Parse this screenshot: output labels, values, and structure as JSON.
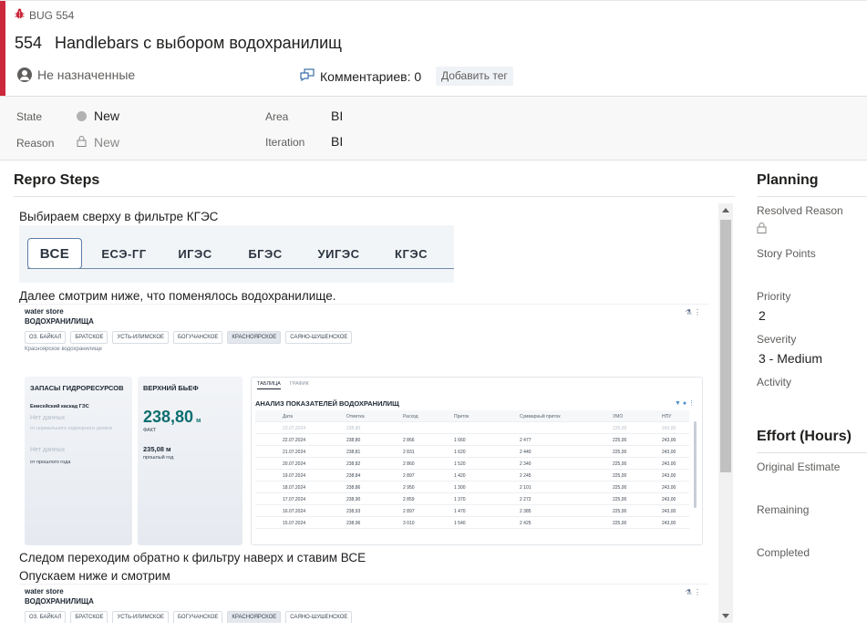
{
  "header": {
    "type_label": "BUG 554",
    "id": "554",
    "title": "Handlebars с выбором водохранилищ",
    "assigned": "Не назначенные",
    "comments": "Комментариев: 0",
    "add_tag": "Добавить тег",
    "accent_color": "#cc293d"
  },
  "fields": {
    "state_label": "State",
    "state_value": "New",
    "reason_label": "Reason",
    "reason_value": "New",
    "area_label": "Area",
    "area_value": "BI",
    "iteration_label": "Iteration",
    "iteration_value": "BI"
  },
  "repro": {
    "title": "Repro Steps",
    "line1": "Выбираем сверху в фильтре КГЭС",
    "tabs": [
      "ВСЕ",
      "ЕСЭ-ГГ",
      "ИГЭС",
      "БГЭС",
      "УИГЭС",
      "КГЭС"
    ],
    "line2": "Далее смотрим ниже, что поменялось водохранилище.",
    "line3": "Следом переходим обратно к фильтру наверх и ставим ВСЕ",
    "line4": "Опускаем ниже и смотрим",
    "dashboard": {
      "app": "water store",
      "section": "ВОДОХРАНИЛИЩА",
      "chips": [
        "ОЗ. БАЙКАЛ",
        "БРАТСКОЕ",
        "УСТЬ-ИЛИМСКОЕ",
        "БОГУЧАНСКОЕ",
        "КРАСНОЯРСКОЕ",
        "САЯНО-ШУШЕНСКОЕ"
      ],
      "selected_note": "Красноярское водохранилище",
      "card1": {
        "title": "ЗАПАСЫ ГИДРОРЕСУРСОВ",
        "sub": "Енисейский каскад ГЭС",
        "nodata1": "Нет данных",
        "note1": "от нормального подпорного уровня",
        "nodata2": "Нет данных",
        "note2": "от прошлого года"
      },
      "card2": {
        "title": "ВЕРХНИЙ БЬЕФ",
        "value": "238,80",
        "unit": "м",
        "value_note": "ФАКТ",
        "prev": "235,08 м",
        "prev_note": "прошлый год"
      },
      "table": {
        "tab_active": "ТАБЛИЦА",
        "tab_other": "ГРАФИК",
        "title": "АНАЛИЗ ПОКАЗАТЕЛЕЙ ВОДОХРАНИЛИЩ",
        "columns": [
          "Дата",
          "Отметка",
          "Расход",
          "Приток",
          "Суммарный приток",
          "УМО",
          "НПУ"
        ],
        "rows": [
          [
            "23.07.2024",
            "238,80",
            "",
            "",
            "",
            "225,00",
            "243,00"
          ],
          [
            "22.07.2024",
            "238,80",
            "2 866",
            "1 660",
            "2 477",
            "225,00",
            "243,00"
          ],
          [
            "21.07.2024",
            "238,81",
            "2 831",
            "1 620",
            "2 440",
            "225,00",
            "243,00"
          ],
          [
            "20.07.2024",
            "238,82",
            "2 860",
            "1 520",
            "2 340",
            "225,00",
            "243,00"
          ],
          [
            "19.07.2024",
            "238,84",
            "2 897",
            "1 420",
            "2 245",
            "225,00",
            "243,00"
          ],
          [
            "18.07.2024",
            "238,86",
            "2 950",
            "1 300",
            "2 101",
            "225,00",
            "243,00"
          ],
          [
            "17.07.2024",
            "238,90",
            "2 859",
            "1 370",
            "2 272",
            "225,00",
            "243,00"
          ],
          [
            "16.07.2024",
            "238,93",
            "2 897",
            "1 470",
            "2 385",
            "225,00",
            "243,00"
          ],
          [
            "15.07.2024",
            "238,96",
            "3 010",
            "1 540",
            "2 425",
            "225,00",
            "243,00"
          ]
        ]
      }
    }
  },
  "planning": {
    "title": "Planning",
    "resolved_reason": "Resolved Reason",
    "story_points": "Story Points",
    "priority_label": "Priority",
    "priority_value": "2",
    "severity_label": "Severity",
    "severity_value": "3 - Medium",
    "activity_label": "Activity",
    "effort_title": "Effort (Hours)",
    "original_estimate": "Original Estimate",
    "remaining": "Remaining",
    "completed": "Completed"
  }
}
